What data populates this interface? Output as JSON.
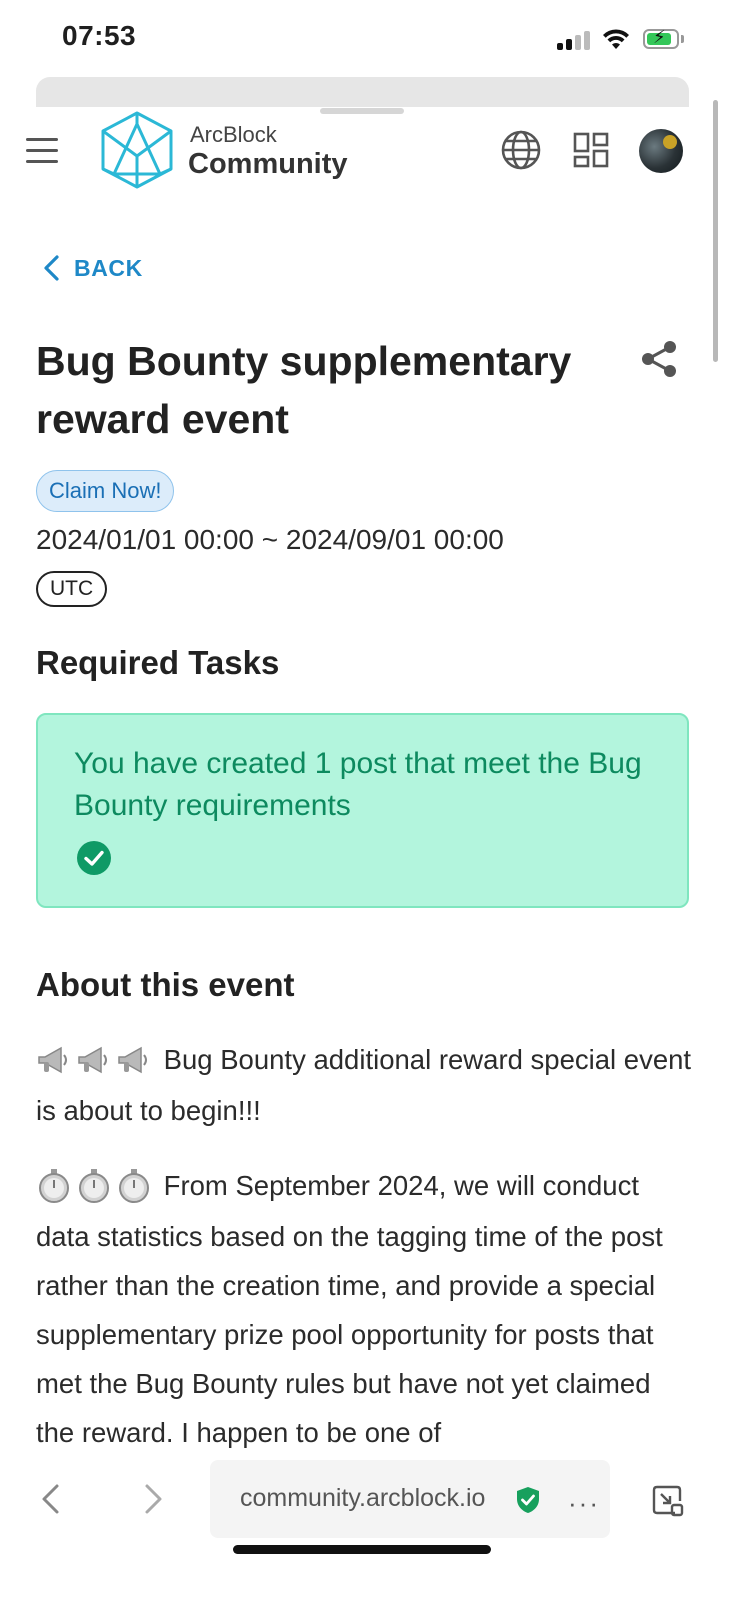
{
  "status_bar": {
    "time": "07:53"
  },
  "header": {
    "brand_top": "ArcBlock",
    "brand_bottom": "Community",
    "icons": [
      "menu-icon",
      "arcblock-logo",
      "globe-icon",
      "apps-grid-icon",
      "avatar"
    ]
  },
  "nav": {
    "back_label": "BACK"
  },
  "event": {
    "title": "Bug Bounty supplementary reward event",
    "badge": "Claim Now!",
    "date_range": "2024/01/01 00:00 ~ 2024/09/01 00:00",
    "timezone": "UTC"
  },
  "tasks": {
    "heading": "Required Tasks",
    "task_text": "You have created 1 post that meet the Bug Bounty requirements",
    "completed": true
  },
  "about": {
    "heading": "About this event",
    "para1": "Bug Bounty additional reward special event is about to begin!!!",
    "para2": "From September 2024, we will conduct data statistics based on the tagging time of the post rather than the creation time, and provide a special supplementary prize pool opportunity for posts that met the Bug Bounty rules but have not yet claimed the reward. I happen to be one of"
  },
  "browser": {
    "url": "community.arcblock.io",
    "more": "···"
  },
  "colors": {
    "accent": "#1e88c7",
    "success_bg": "#b3f5dd",
    "success_text": "#0d8a5f",
    "badge_bg": "#dcecfa"
  }
}
